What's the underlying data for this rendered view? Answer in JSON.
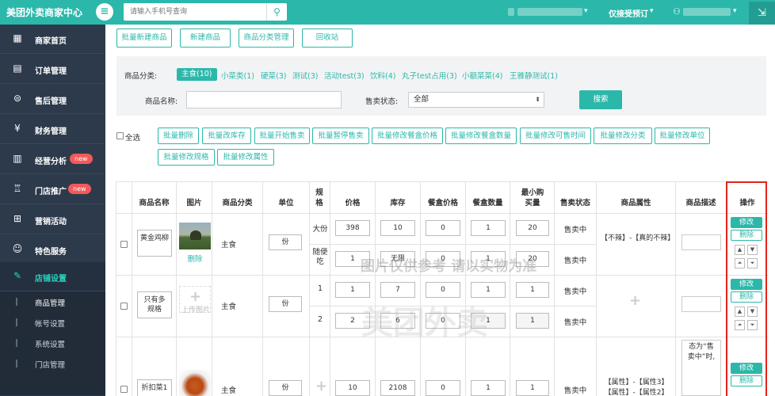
{
  "header": {
    "title": "美团外卖商家中心",
    "search_placeholder": "请输入手机号查询",
    "booking_label": "仅接受预订",
    "user_label": "",
    "colors": {
      "primary": "#2bb8aa",
      "sidebar": "#2d3a4b"
    }
  },
  "sidebar": {
    "items": [
      {
        "label": "商家首页",
        "icon": "store-icon"
      },
      {
        "label": "订单管理",
        "icon": "order-icon"
      },
      {
        "label": "售后管理",
        "icon": "after-sales-icon"
      },
      {
        "label": "财务管理",
        "icon": "finance-icon"
      },
      {
        "label": "经营分析",
        "icon": "chart-icon",
        "badge": "new"
      },
      {
        "label": "门店推广",
        "icon": "promotion-icon",
        "badge": "new"
      },
      {
        "label": "营销活动",
        "icon": "gift-icon"
      },
      {
        "label": "特色服务",
        "icon": "service-icon"
      },
      {
        "label": "店铺设置",
        "icon": "wrench-icon"
      }
    ],
    "sub_items": [
      "商品管理",
      "帐号设置",
      "系统设置",
      "门店管理"
    ]
  },
  "toolbar": {
    "buttons": [
      "批量新建商品",
      "新建商品",
      "商品分类管理",
      "回收站"
    ]
  },
  "filter": {
    "category_label": "商品分类:",
    "categories": [
      "主食(10)",
      "小菜类(1)",
      "硬菜(3)",
      "测试(3)",
      "活动test(3)",
      "饮料(4)",
      "丸子test占用(3)",
      "小额菜菜(4)",
      "王雅静测试(1)"
    ],
    "name_label": "商品名称:",
    "status_label": "售卖状态:",
    "status_value": "全部",
    "search_button": "搜索"
  },
  "batch": {
    "select_all": "全选",
    "buttons": [
      "批量删除",
      "批量改库存",
      "批量开始售卖",
      "批量暂停售卖",
      "批量修改餐盒价格",
      "批量修改餐盒数量",
      "批量修改可售时间",
      "批量修改分类",
      "批量修改单位",
      "批量修改规格",
      "批量修改属性"
    ]
  },
  "table": {
    "headers": [
      "商品名称",
      "图片",
      "商品分类",
      "单位",
      "规格",
      "价格",
      "库存",
      "餐盒价格",
      "餐盒数量",
      "最小购买量",
      "售卖状态",
      "商品属性",
      "商品描述",
      "操作"
    ],
    "rows": [
      {
        "name": "黄金鸡柳",
        "image_action": "删除",
        "category": "主食",
        "unit": "份",
        "attribute": "【不辣】-【真的不辣】",
        "specs": [
          {
            "spec": "大份",
            "price": "398",
            "stock": "10",
            "box_price": "0",
            "box_qty": "1",
            "min_buy": "20",
            "status": "售卖中"
          },
          {
            "spec": "随便吃",
            "price": "1",
            "stock": "无限",
            "box_price": "0",
            "box_qty": "1",
            "min_buy": "20",
            "status": "售卖中"
          }
        ]
      },
      {
        "name": "只有多规格",
        "image_action": "上传图片",
        "category": "主食",
        "unit": "份",
        "attribute": "",
        "specs": [
          {
            "spec": "1",
            "price": "1",
            "stock": "7",
            "box_price": "0",
            "box_qty": "1",
            "min_buy": "1",
            "status": "售卖中"
          },
          {
            "spec": "2",
            "price": "2",
            "stock": "6",
            "box_price": "0",
            "box_qty": "1",
            "min_buy": "1",
            "status": "售卖中"
          }
        ]
      },
      {
        "name": "折扣菜1",
        "image_action": "",
        "category": "主食",
        "unit": "份",
        "attribute": "【属性】-【属性3】【属性】-【属性2】",
        "description": "态为“售卖中”时,",
        "specs": [
          {
            "spec": "",
            "price": "10",
            "stock": "2108",
            "box_price": "0",
            "box_qty": "1",
            "min_buy": "1",
            "status": "售卖中"
          }
        ]
      }
    ],
    "edit_label": "修改",
    "delete_label": "删除"
  },
  "watermark": "图片仅供参考 请以实物为准",
  "watermark_brand": "美团外卖"
}
